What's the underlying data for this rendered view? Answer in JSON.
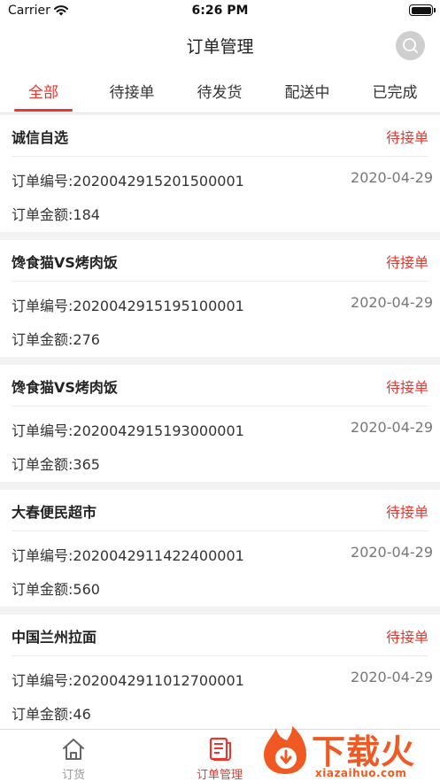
{
  "status_bar": {
    "carrier": "Carrier",
    "time": "6:26 PM"
  },
  "header": {
    "title": "订单管理",
    "search_icon": "search-icon"
  },
  "tabs": [
    {
      "label": "全部",
      "active": true
    },
    {
      "label": "待接单",
      "active": false
    },
    {
      "label": "待发货",
      "active": false
    },
    {
      "label": "配送中",
      "active": false
    },
    {
      "label": "已完成",
      "active": false
    }
  ],
  "orders": [
    {
      "store": "诚信自选",
      "status": "待接单",
      "order_no": "订单编号:2020042915201500001",
      "date": "2020-04-29",
      "amount": "订单金额:184"
    },
    {
      "store": "馋食猫VS烤肉饭",
      "status": "待接单",
      "order_no": "订单编号:2020042915195100001",
      "date": "2020-04-29",
      "amount": "订单金额:276"
    },
    {
      "store": "馋食猫VS烤肉饭",
      "status": "待接单",
      "order_no": "订单编号:2020042915193000001",
      "date": "2020-04-29",
      "amount": "订单金额:365"
    },
    {
      "store": "大春便民超市",
      "status": "待接单",
      "order_no": "订单编号:2020042911422400001",
      "date": "2020-04-29",
      "amount": "订单金额:560"
    },
    {
      "store": "中国兰州拉面",
      "status": "待接单",
      "order_no": "订单编号:2020042911012700001",
      "date": "2020-04-29",
      "amount": "订单金额:46"
    }
  ],
  "tabbar": [
    {
      "label": "订货",
      "icon": "home-icon",
      "active": false
    },
    {
      "label": "订单管理",
      "icon": "order-list-icon",
      "active": true
    }
  ],
  "watermark": {
    "text": "下载火",
    "url": "xiazaihuo.com"
  },
  "colors": {
    "accent": "#e8372e",
    "watermark": "#f05a22"
  }
}
